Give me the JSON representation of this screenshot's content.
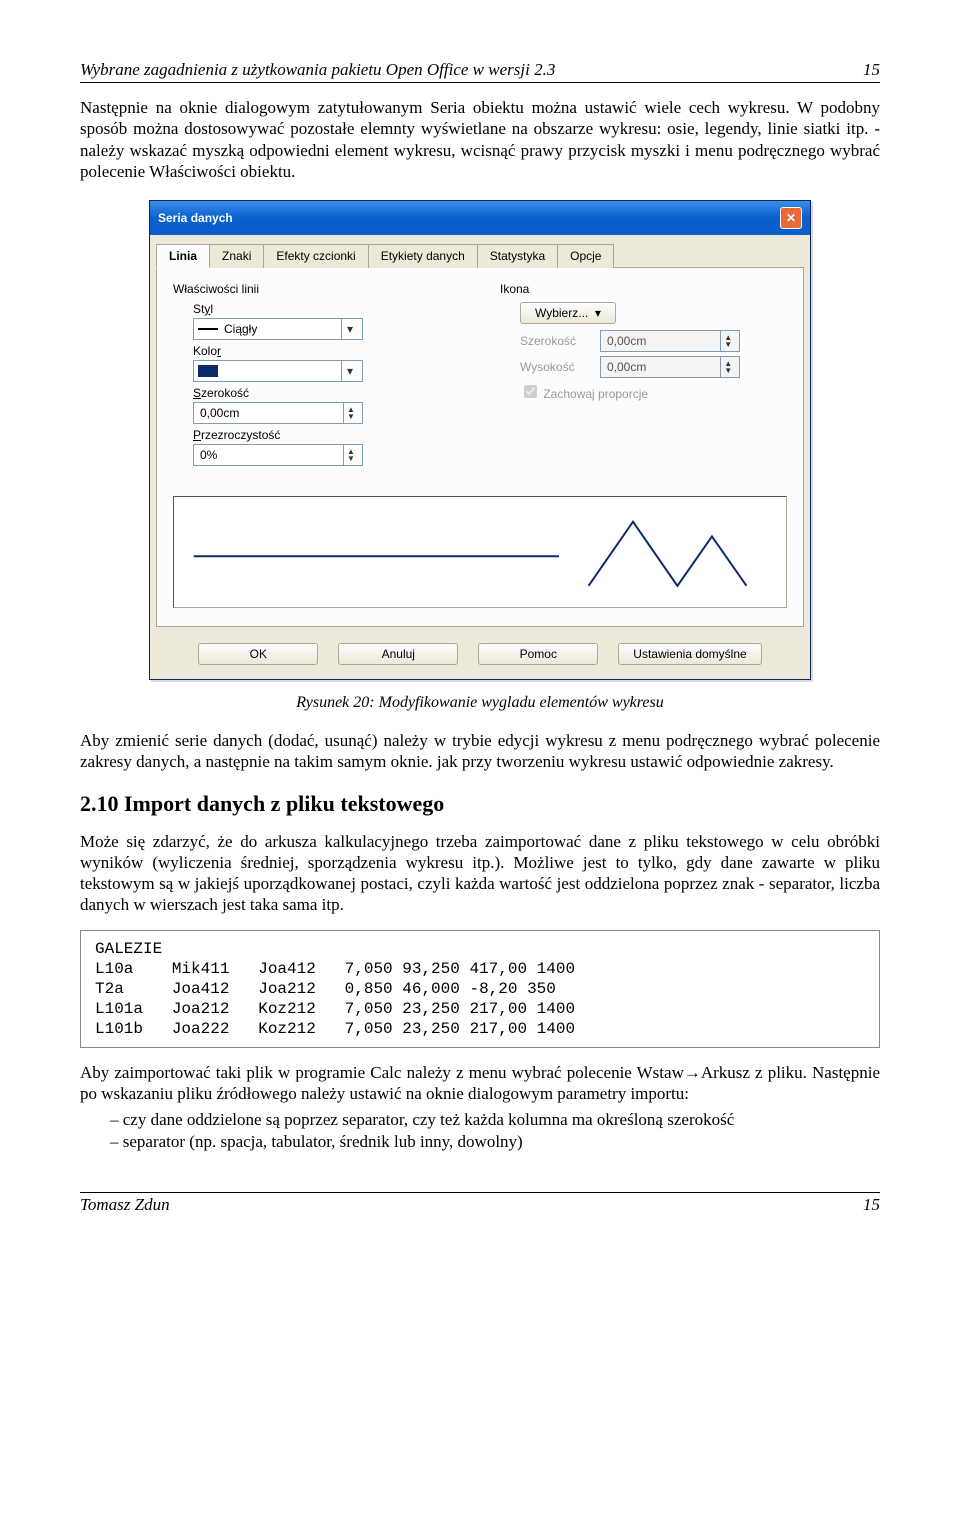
{
  "header": {
    "title": "Wybrane zagadnienia z użytkowania pakietu Open Office w wersji 2.3",
    "page_num": "15"
  },
  "p1": "Następnie na oknie dialogowym zatytułowanym Seria obiektu można ustawić wiele cech wykresu. W podobny sposób można dostosowywać pozostałe elemnty wyświetlane na obszarze wykresu: osie, legendy, linie siatki itp. - należy wskazać myszką odpowiedni element wykresu, wcisnąć prawy przycisk myszki i menu podręcznego wybrać polecenie Właściwości obiektu.",
  "dialog": {
    "title": "Seria danych",
    "close_glyph": "✕",
    "tabs": [
      "Linia",
      "Znaki",
      "Efekty czcionki",
      "Etykiety danych",
      "Statystyka",
      "Opcje"
    ],
    "left": {
      "group": "Właściwości linii",
      "styl_label": "Styl",
      "styl_value": "Ciągły",
      "kolor_label": "Kolor",
      "szer_label": "Szerokość",
      "szer_value": "0,00cm",
      "prz_label": "Przezroczystość",
      "prz_value": "0%"
    },
    "right": {
      "group": "Ikona",
      "wybierz": "Wybierz...",
      "szer": "Szerokość",
      "szer_v": "0,00cm",
      "wys": "Wysokość",
      "wys_v": "0,00cm",
      "chk": "Zachowaj proporcje"
    },
    "buttons": {
      "ok": "OK",
      "anuluj": "Anuluj",
      "pomoc": "Pomoc",
      "domyslne": "Ustawienia domyślne"
    }
  },
  "caption": "Rysunek 20: Modyfikowanie wygladu elementów wykresu",
  "p2": "Aby zmienić serie danych (dodać, usunąć) należy w trybie edycji wykresu z menu podręcznego wybrać polecenie zakresy danych, a następnie na takim samym oknie. jak przy tworzeniu wykresu ustawić odpowiednie zakresy.",
  "section_title": "2.10   Import danych z pliku tekstowego",
  "p3": "Może się zdarzyć, że do arkusza kalkulacyjnego trzeba zaimportować dane z pliku tekstowego w celu obróbki wyników (wyliczenia średniej, sporządzenia wykresu itp.). Możliwe jest to tylko, gdy dane zawarte w pliku tekstowym są w jakiejś uporządkowanej postaci, czyli każda wartość jest oddzielona poprzez znak - separator, liczba danych w wierszach jest taka sama itp.",
  "codeblock": "GALEZIE\nL10a    Mik411   Joa412   7,050 93,250 417,00 1400\nT2a     Joa412   Joa212   0,850 46,000 -8,20 350\nL101a   Joa212   Koz212   7,050 23,250 217,00 1400\nL101b   Joa222   Koz212   7,050 23,250 217,00 1400",
  "p4": "Aby zaimportować taki plik w programie Calc należy z menu wybrać polecenie Wstaw→Arkusz z pliku. Następnie po wskazaniu pliku źródłowego należy ustawić na oknie dialogowym parametry importu:",
  "bullets": [
    "czy dane oddzielone są poprzez separator, czy też każda kolumna ma określoną szerokość",
    "separator (np. spacja, tabulator, średnik lub inny, dowolny)"
  ],
  "footer": {
    "author": "Tomasz Zdun",
    "page_num": "15"
  }
}
